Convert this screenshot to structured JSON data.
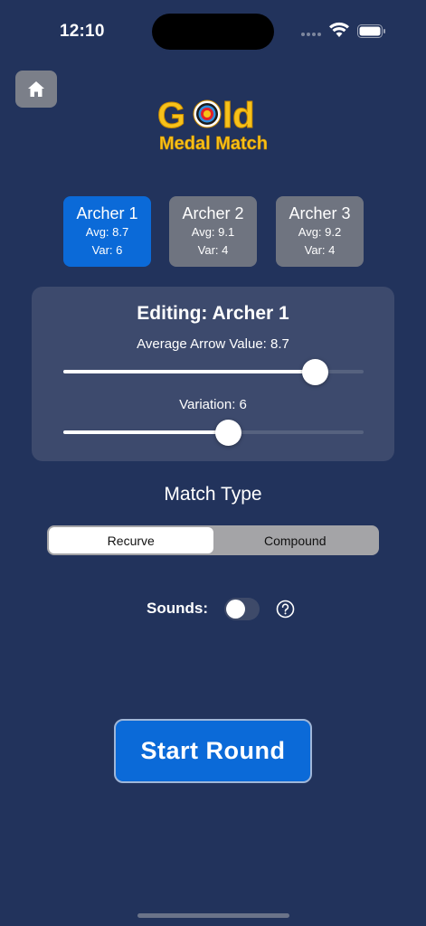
{
  "status_bar": {
    "time": "12:10",
    "wifi_icon": "wifi-icon",
    "battery_icon": "battery-icon"
  },
  "header": {
    "home_icon": "house-icon",
    "logo_text_top": "Gold",
    "logo_text_bottom": "Medal Match",
    "logo_color": "#f7c21a"
  },
  "archers": [
    {
      "name": "Archer 1",
      "avg": "Avg: 8.7",
      "var": "Var: 6",
      "selected": true
    },
    {
      "name": "Archer 2",
      "avg": "Avg: 9.1",
      "var": "Var: 4",
      "selected": false
    },
    {
      "name": "Archer 3",
      "avg": "Avg: 9.2",
      "var": "Var: 4",
      "selected": false
    }
  ],
  "editor": {
    "title": "Editing: Archer 1",
    "average_label": "Average Arrow Value: 8.7",
    "average_value": 8.7,
    "average_fraction": 0.84,
    "variation_label": "Variation: 6",
    "variation_value": 6,
    "variation_fraction": 0.55
  },
  "match_type": {
    "label": "Match Type",
    "options": [
      "Recurve",
      "Compound"
    ],
    "selected": "Recurve"
  },
  "sounds": {
    "label": "Sounds:",
    "enabled": false,
    "help_icon": "question-circle-icon"
  },
  "start_button": {
    "label": "Start Round"
  },
  "colors": {
    "background": "#22335c",
    "accent": "#0b6ad8",
    "panel": "#3d4a6d",
    "gold": "#f7c21a"
  }
}
